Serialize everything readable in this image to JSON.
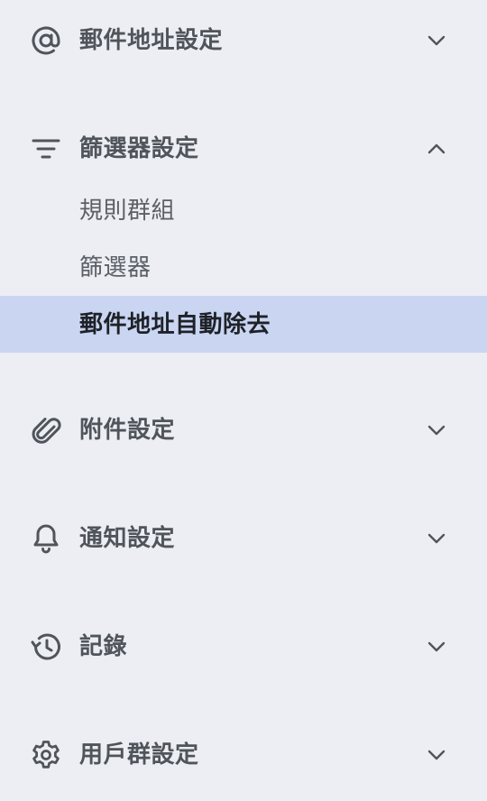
{
  "menu": {
    "sections": [
      {
        "label": "郵件地址設定",
        "icon": "at-sign-icon",
        "expanded": false
      },
      {
        "label": "篩選器設定",
        "icon": "filter-icon",
        "expanded": true,
        "items": [
          {
            "label": "規則群組",
            "active": false
          },
          {
            "label": "篩選器",
            "active": false
          },
          {
            "label": "郵件地址自動除去",
            "active": true
          }
        ]
      },
      {
        "label": "附件設定",
        "icon": "paperclip-icon",
        "expanded": false
      },
      {
        "label": "通知設定",
        "icon": "bell-icon",
        "expanded": false
      },
      {
        "label": "記錄",
        "icon": "history-icon",
        "expanded": false
      },
      {
        "label": "用戶群設定",
        "icon": "gear-icon",
        "expanded": false
      }
    ]
  },
  "colors": {
    "background": "#eceef3",
    "active_background": "#c9d5f1",
    "text": "#50545b",
    "active_text": "#1e2127"
  }
}
